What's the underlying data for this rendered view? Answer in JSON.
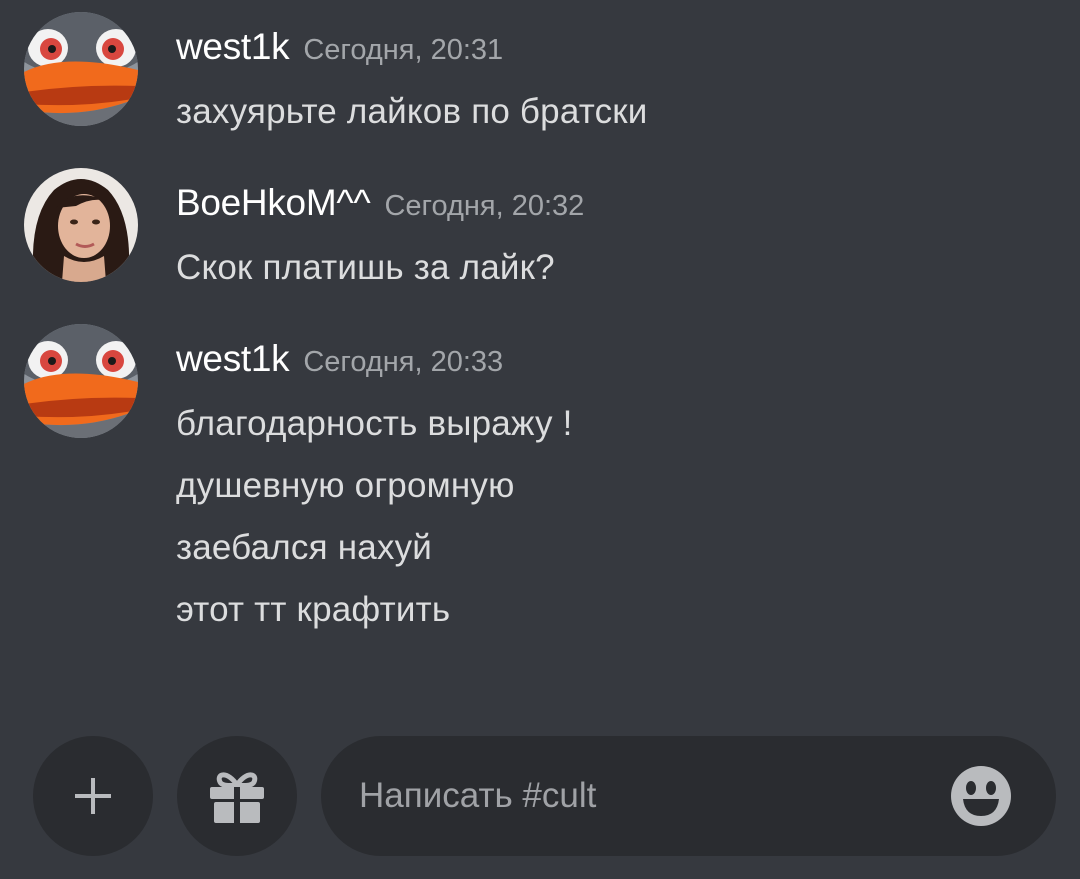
{
  "messages": [
    {
      "username": "west1k",
      "timestamp": "Сегодня, 20:31",
      "avatar": "penguin-avatar",
      "lines": [
        "захуярьте лайков по братски"
      ]
    },
    {
      "username": "BoeHkoM^^",
      "timestamp": "Сегодня, 20:32",
      "avatar": "woman-portrait-avatar",
      "lines": [
        "Скок платишь за лайк?"
      ]
    },
    {
      "username": "west1k",
      "timestamp": "Сегодня, 20:33",
      "avatar": "penguin-avatar",
      "lines": [
        "благодарность выражу !",
        "душевную огромную",
        "заебался нахуй",
        "этот тт крафтить"
      ]
    }
  ],
  "composer": {
    "placeholder": "Написать #cult",
    "add_icon": "plus-icon",
    "gift_icon": "gift-icon",
    "emoji_icon": "smiley-icon"
  },
  "colors": {
    "background": "#36393f",
    "button_background": "#2a2c30",
    "username": "#ffffff",
    "timestamp": "#a3a6aa",
    "message_text": "#dcddde"
  }
}
